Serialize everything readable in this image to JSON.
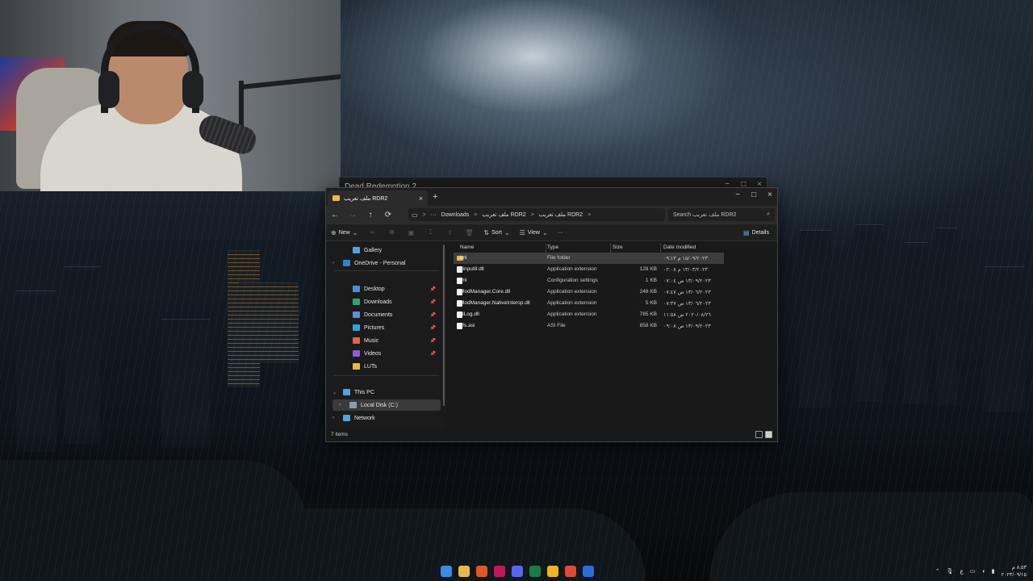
{
  "background_window": {
    "title": "Dead Redemption 2"
  },
  "explorer": {
    "tab_label": "ملف تعريب RDR2",
    "tab_close": "×",
    "new_tab": "+",
    "window_controls": {
      "minimize": "−",
      "maximize": "□",
      "close": "×"
    },
    "nav": {
      "back": "←",
      "forward": "→",
      "up": "↑",
      "refresh": "⟳"
    },
    "address": {
      "segments": [
        "Downloads",
        "ملف تعريب RDR2",
        "ملف تعريب RDR2"
      ],
      "separator": ">",
      "more": "···"
    },
    "search": {
      "placeholder": "Search ملف تعريب RDR2",
      "icon": "⌕"
    },
    "toolbar": {
      "new_label": "New",
      "sort_label": "Sort",
      "view_label": "View",
      "more_label": "···",
      "details_label": "Details"
    },
    "sidebar": {
      "items": [
        {
          "label": "Gallery",
          "icon": "gallery-icon",
          "color": "#4fa3e0",
          "pinned": false
        },
        {
          "label": "OneDrive - Personal",
          "icon": "cloud-icon",
          "color": "#2f7fd6",
          "pinned": false
        },
        {
          "label": "Desktop",
          "icon": "desktop-icon",
          "color": "#4a90d9",
          "pinned": true
        },
        {
          "label": "Downloads",
          "icon": "downloads-icon",
          "color": "#33a36b",
          "pinned": true
        },
        {
          "label": "Documents",
          "icon": "documents-icon",
          "color": "#5b8fd8",
          "pinned": true
        },
        {
          "label": "Pictures",
          "icon": "pictures-icon",
          "color": "#3aa0d8",
          "pinned": true
        },
        {
          "label": "Music",
          "icon": "music-icon",
          "color": "#e0634b",
          "pinned": true
        },
        {
          "label": "Videos",
          "icon": "videos-icon",
          "color": "#8a5bd8",
          "pinned": true
        },
        {
          "label": "LUTs",
          "icon": "folder-icon",
          "color": "#e9b84a",
          "pinned": false
        },
        {
          "label": "This PC",
          "icon": "pc-icon",
          "color": "#4fa3e0",
          "pinned": false
        },
        {
          "label": "Local Disk (C:)",
          "icon": "disk-icon",
          "color": "#8f9aa6",
          "pinned": false
        },
        {
          "label": "Network",
          "icon": "network-icon",
          "color": "#4fa3e0",
          "pinned": false
        }
      ]
    },
    "columns": {
      "name": "Name",
      "type": "Type",
      "size": "Size",
      "date": "Date modified"
    },
    "files": [
      {
        "name": "lml",
        "type": "File folder",
        "size": "",
        "date": "١٥/٠٩/٢٠٢٣ م ٠٩:١٣",
        "kind": "folder"
      },
      {
        "name": "dinput8.dll",
        "type": "Application extension",
        "size": "128 KB",
        "date": "١٣/٠٣/٢٠٢٣ م ٠٢:٠٨",
        "kind": "file"
      },
      {
        "name": "lml",
        "type": "Configuration settings",
        "size": "1 KB",
        "date": "١٣/٠٩/٢٠٢٣ ص ٠٧:٠٤",
        "kind": "file"
      },
      {
        "name": "ModManager.Core.dll",
        "type": "Application extension",
        "size": "248 KB",
        "date": "١٣/٠٦/٢٠٢٣ ص ٠٧:٤٧",
        "kind": "file"
      },
      {
        "name": "ModManager.NativeInterop.dll",
        "type": "Application extension",
        "size": "5 KB",
        "date": "١٣/٠٦/٢٠٢٣ ص ٠٧:٣٧",
        "kind": "file"
      },
      {
        "name": "NLog.dll",
        "type": "Application extension",
        "size": "785 KB",
        "date": "٢٠٢٠/٠٨/٢٦ ص ١١:٥٨",
        "kind": "file"
      },
      {
        "name": "vfs.asi",
        "type": "ASI File",
        "size": "858 KB",
        "date": "١٣/٠٩/٢٠٢٣ ص ٠٩:٠٨",
        "kind": "file"
      }
    ],
    "status": {
      "count": "7 items"
    }
  },
  "taskbar": {
    "apps": [
      {
        "name": "start",
        "color": "#3c8de0"
      },
      {
        "name": "file-explorer",
        "color": "#e9b84a"
      },
      {
        "name": "brave",
        "color": "#e2572b"
      },
      {
        "name": "affinity",
        "color": "#c2185b"
      },
      {
        "name": "discord",
        "color": "#5865f2"
      },
      {
        "name": "excel",
        "color": "#1d7a45"
      },
      {
        "name": "app-yellow",
        "color": "#f0b323"
      },
      {
        "name": "chrome",
        "color": "#dd4b3e"
      },
      {
        "name": "app-blue",
        "color": "#2e6bd8"
      }
    ],
    "tray": {
      "language": "ع",
      "time": "٨:٥٣ م",
      "date": "٢٠٢٣/٠٩/١٥"
    }
  }
}
